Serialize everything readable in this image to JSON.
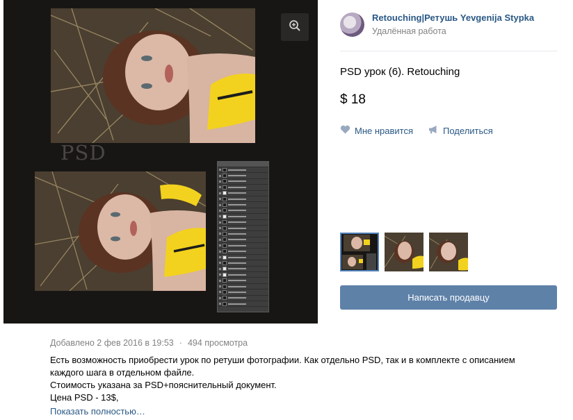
{
  "seller": {
    "name": "Retouching|Ретушь Yevgenija Stypka",
    "subtitle": "Удалённая работа"
  },
  "product": {
    "title": "PSD урок (6). Retouching",
    "price": "$ 18",
    "like_label": "Мне нравится",
    "share_label": "Поделиться",
    "write_seller_label": "Написать продавцу"
  },
  "photo": {
    "psd_label": "PSD",
    "zoom_icon": "zoom-in-icon"
  },
  "meta": {
    "added": "Добавлено 2 фев 2016 в 19:53",
    "separator": "·",
    "views": "494 просмотра"
  },
  "description": {
    "line1": "Есть возможность приобрести урок по ретуши фотографии. Как отдельно PSD, так и в комплекте с описанием",
    "line2": "каждого шага в отдельном файле.",
    "line3": "Стоимость указана за PSD+пояснительный документ.",
    "line4": "Цена PSD - 13$,",
    "show_more": "Показать полностью…"
  },
  "colors": {
    "link": "#2a5885",
    "button": "#5e81a8",
    "muted": "#828282",
    "photo_bg": "#181615",
    "accent_yellow": "#f2d21e"
  }
}
